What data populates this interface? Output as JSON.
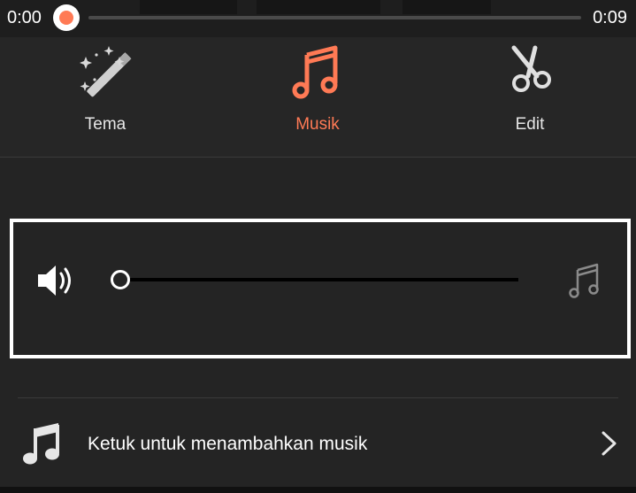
{
  "timeline": {
    "time_start": "0:00",
    "time_end": "0:09",
    "progress_fraction": 0.0
  },
  "tabs": [
    {
      "label": "Tema",
      "icon": "magic-wand-icon",
      "active": false
    },
    {
      "label": "Musik",
      "icon": "music-note-icon",
      "active": true
    },
    {
      "label": "Edit",
      "icon": "scissors-icon",
      "active": false
    }
  ],
  "volume_panel": {
    "speaker_icon": "speaker-icon",
    "level_fraction": 0.0,
    "music_icon": "music-note-icon"
  },
  "add_music": {
    "label": "Ketuk untuk menambahkan musik",
    "icon": "music-note-icon",
    "chevron": "chevron-right-icon"
  },
  "colors": {
    "accent": "#ff7a55",
    "background": "#242424",
    "text": "#ffffff",
    "dim_icon": "#8a8a8a"
  }
}
